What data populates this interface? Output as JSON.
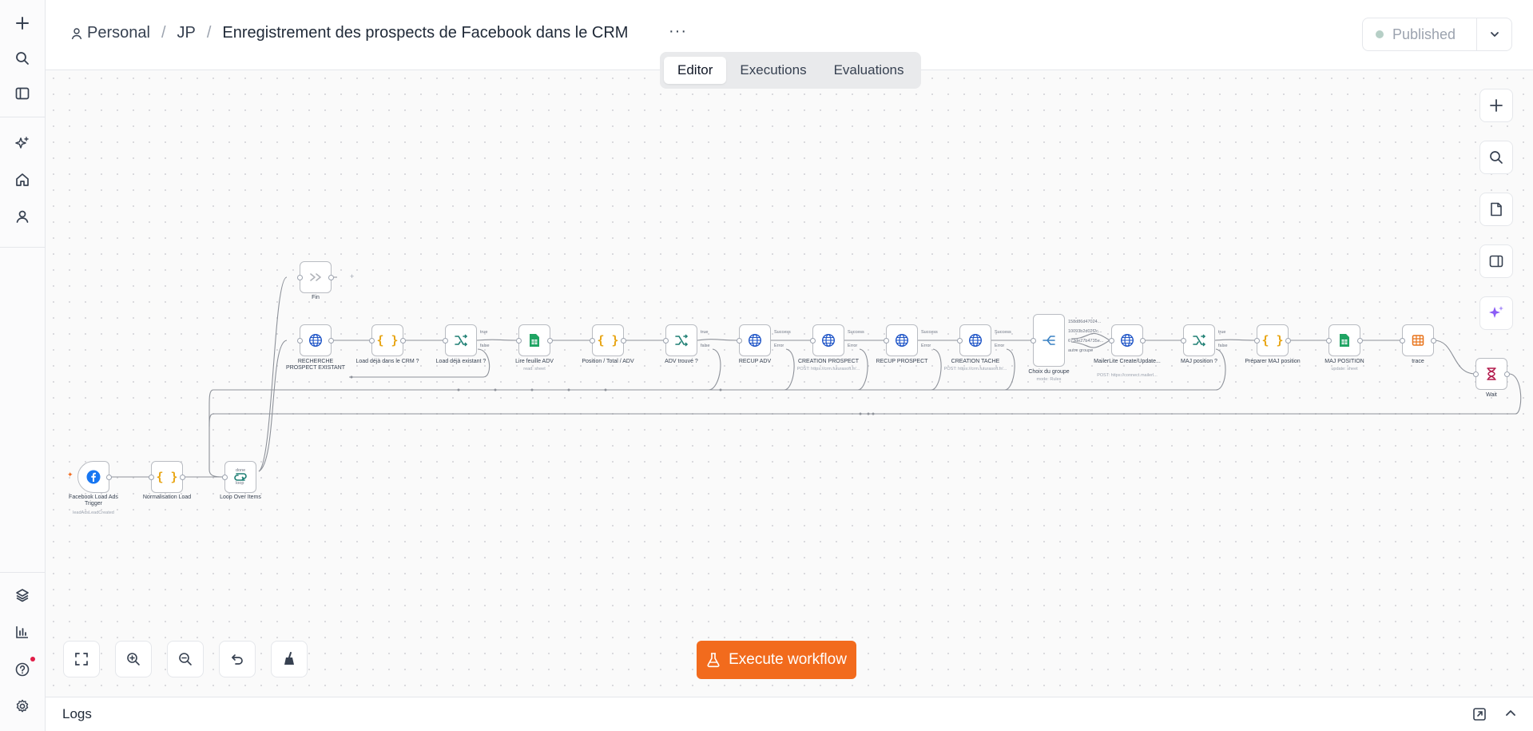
{
  "breadcrumb": {
    "project": "Personal",
    "folder": "JP",
    "workflow_title": "Enregistrement des prospects de Facebook dans le CRM"
  },
  "header": {
    "more_label": "···",
    "publish_label": "Published"
  },
  "tabs": [
    {
      "label": "Editor",
      "active": true
    },
    {
      "label": "Executions",
      "active": false
    },
    {
      "label": "Evaluations",
      "active": false
    }
  ],
  "canvas": {
    "nodes": {
      "trigger": {
        "label": "Facebook Load Ads Trigger",
        "sub": "leadAdsLeadCreated"
      },
      "normalisation": {
        "label": "Normalisation Load"
      },
      "loop": {
        "label": "Loop Over Items",
        "out_done": "done",
        "out_loop": "loop"
      },
      "fin": {
        "label": "Fin"
      },
      "recherche": {
        "label": "RECHERCHE PROSPECT EXISTANT"
      },
      "load_crm": {
        "label": "Load déjà dans le CRM ?"
      },
      "load_existant": {
        "label": "Load déjà existant ?",
        "out_true": "true",
        "out_false": "false"
      },
      "lire": {
        "label": "Lire feuille ADV",
        "sub": "read: sheet"
      },
      "position": {
        "label": "Position / Total / ADV"
      },
      "adv_trouve": {
        "label": "ADV trouvé ?",
        "out_true": "true",
        "out_false": "false"
      },
      "recup_adv": {
        "label": "RECUP ADV",
        "out_success": "Success",
        "out_error": "Error"
      },
      "creation_prospect": {
        "label": "CREATION PROSPECT",
        "sub": "POST: https://crm.futurasoft.fr/...",
        "out_success": "Success",
        "out_error": "Error"
      },
      "recup_prospect": {
        "label": "RECUP PROSPECT",
        "out_success": "Success",
        "out_error": "Error"
      },
      "creation_tache": {
        "label": "CREATION TACHE",
        "sub": "POST: https://crm.futurasoft.fr/...",
        "out_success": "Success",
        "out_error": "Error"
      },
      "choix": {
        "label": "Choix du groupe",
        "sub": "mode: Rules",
        "outputs": [
          "158d86d47024...",
          "10093b2d02f2c...",
          "673de27b4735e...",
          "autre groupe"
        ]
      },
      "mailerlite": {
        "label": "MailerLite Create/Update...",
        "sub": "POST: https://connect.mailerl..."
      },
      "maj_pos": {
        "label": "MAJ position ?",
        "out_true": "true",
        "out_false": "false"
      },
      "preparer": {
        "label": "Préparer MAJ position"
      },
      "maj_position": {
        "label": "MAJ POSITION",
        "sub": "update: sheet"
      },
      "trace": {
        "label": "trace"
      },
      "wait": {
        "label": "Wait"
      }
    },
    "add_node_label": "+"
  },
  "actions": {
    "execute_label": "Execute workflow"
  },
  "logs": {
    "label": "Logs"
  },
  "colors": {
    "accent": "#f26b1d",
    "node_border": "#b9bcc2",
    "http_blue": "#1f55c7",
    "code_orange": "#e8a514",
    "sheets_green": "#1fa463",
    "switch_teal": "#1e7f74",
    "ai_purple": "#8b5cf6"
  }
}
